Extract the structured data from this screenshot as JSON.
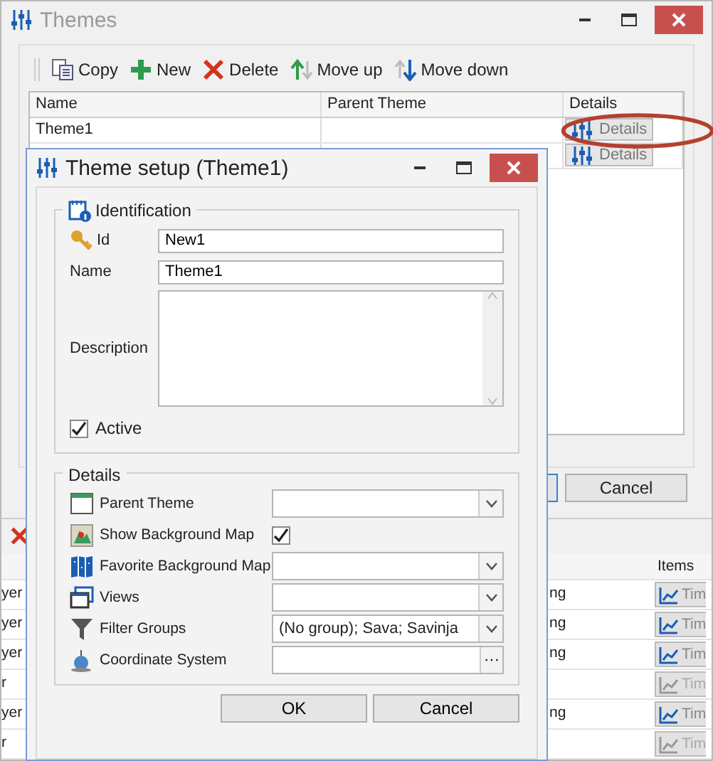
{
  "themes_window": {
    "title": "Themes",
    "active": false,
    "toolbar": [
      {
        "kind": "copy",
        "label": "Copy"
      },
      {
        "kind": "new",
        "label": "New"
      },
      {
        "kind": "delete",
        "label": "Delete"
      },
      {
        "kind": "move_up",
        "label": "Move up"
      },
      {
        "kind": "move_down",
        "label": "Move down"
      }
    ],
    "table": {
      "columns": [
        "Name",
        "Parent Theme",
        "Details"
      ],
      "rows": [
        {
          "name": "Theme1",
          "details": "Details"
        },
        {
          "details": "Details"
        }
      ]
    },
    "buttons": [
      "Cancel"
    ]
  },
  "background_window": {
    "table": {
      "columns": [
        "Items"
      ],
      "rows": [
        {
          "column_1": "yer",
          "column_2": "ng",
          "items": "Tim",
          "disabled": false
        },
        {
          "column_1": "yer",
          "column_2": "ng",
          "items": "Tim",
          "disabled": false
        },
        {
          "column_1": "yer",
          "column_2": "ng",
          "items": "Tim",
          "disabled": false
        },
        {
          "column_1": "r",
          "items": "Tim",
          "disabled": true
        },
        {
          "column_1": "yer",
          "column_2": "ng",
          "items": "Tim",
          "disabled": false
        },
        {
          "column_1": "r",
          "items": "Tim",
          "disabled": true
        }
      ]
    }
  },
  "dialog": {
    "title": "Theme setup (Theme1)",
    "active": true,
    "identification": {
      "title": "Identification",
      "fields": [
        {
          "kind": "text",
          "label": "Id",
          "value": "New1"
        },
        {
          "kind": "text",
          "label": "Name",
          "value": "Theme1"
        },
        {
          "kind": "textarea",
          "label": "Description"
        },
        {
          "kind": "checkbox",
          "label": "Active",
          "checked": true
        }
      ]
    },
    "details": {
      "title": "Details",
      "fields": [
        {
          "kind": "combo",
          "label": "Parent Theme"
        },
        {
          "kind": "checkbox",
          "label": "Show Background Map",
          "checked": true
        },
        {
          "kind": "combo",
          "label": "Favorite Background Map"
        },
        {
          "kind": "combo",
          "label": "Views"
        },
        {
          "kind": "combo",
          "label": "Filter Groups",
          "value": "(No group); Sava; Savinja"
        },
        {
          "kind": "browse",
          "label": "Coordinate System",
          "button": "···"
        }
      ]
    },
    "buttons": [
      "OK",
      "Cancel"
    ]
  }
}
